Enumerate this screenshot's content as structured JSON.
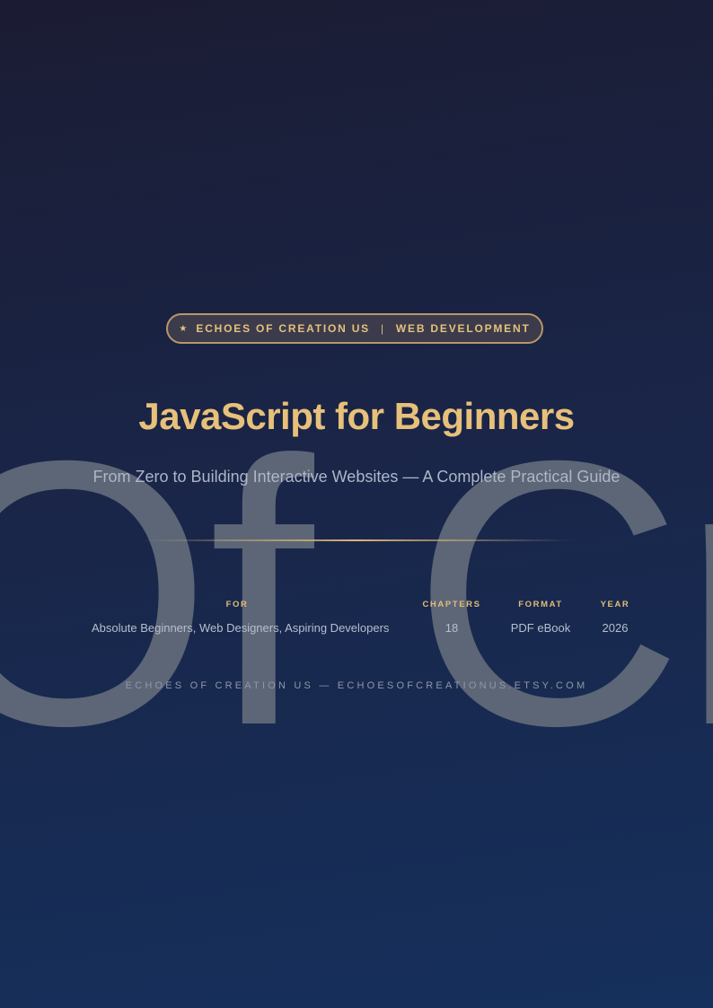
{
  "watermark": {
    "text": "Of Cre"
  },
  "badge": {
    "star": "★",
    "brand": "ECHOES OF CREATION US",
    "separator": "|",
    "category": "WEB DEVELOPMENT"
  },
  "title": "JavaScript for Beginners",
  "subtitle": "From Zero to Building Interactive Websites — A Complete Practical Guide",
  "meta": {
    "for": {
      "label": "FOR",
      "value": "Absolute Beginners, Web Designers, Aspiring Developers"
    },
    "chapters": {
      "label": "CHAPTERS",
      "value": "18"
    },
    "format": {
      "label": "FORMAT",
      "value": "PDF eBook"
    },
    "year": {
      "label": "YEAR",
      "value": "2026"
    }
  },
  "footer": "ECHOES OF CREATION US — ECHOESOFCREATIONUS.ETSY.COM",
  "colors": {
    "accent_gold": "#e7c07a",
    "background_top": "#1b1c33",
    "background_bottom": "#15305c",
    "text_muted": "#aeb6c7"
  }
}
